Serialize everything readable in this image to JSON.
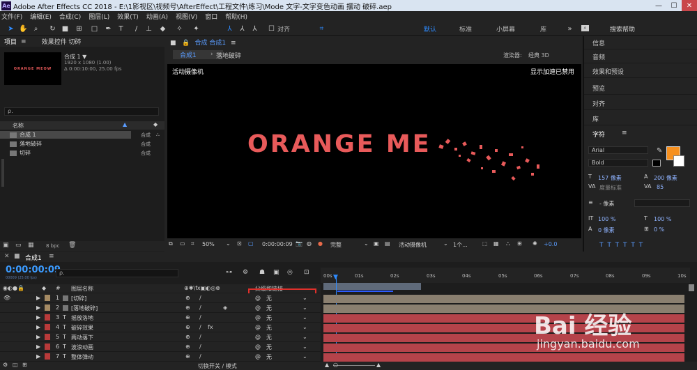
{
  "window": {
    "logo": "Ae",
    "title": "Adobe After Effects CC 2018 - E:\\1影视区\\视频号\\AfterEffect\\工程文件\\练习\\Mode 文字-文字变色动画 摆动 破碎.aep",
    "min": "—",
    "max": "☐",
    "close": "✕"
  },
  "menu": [
    "文件(F)",
    "编辑(E)",
    "合成(C)",
    "图层(L)",
    "效果(T)",
    "动画(A)",
    "视图(V)",
    "窗口",
    "帮助(H)"
  ],
  "toolbar": {
    "align_label": "对齐",
    "workspaces": [
      "默认",
      "标准",
      "小屏幕",
      "库"
    ],
    "search_placeholder": "搜索帮助"
  },
  "project": {
    "tab_project": "项目",
    "tab_effects": "效果控件 切碎",
    "comp_name": "合成 1 ▼",
    "comp_size": "1920 x 1080 (1.00)",
    "comp_duration": "Δ 0:00:10:00, 25.00 fps",
    "thumb_text": "ORANGE MEOW",
    "search_placeholder": "ρ.",
    "col_name": "名称",
    "items": [
      {
        "name": "合成 1",
        "type": "合成"
      },
      {
        "name": "落地破碎",
        "type": "合成"
      },
      {
        "name": "切碎",
        "type": "合成"
      }
    ],
    "bpc": "8 bpc"
  },
  "viewer": {
    "tab_label": "合成 合成1",
    "sub_tab_comp": "合成1",
    "sub_tab_other": "落地破碎",
    "renderer": "渲染器:",
    "renderer_value": "经典 3D",
    "camera_label": "活动摄像机",
    "accel_label": "显示加速已禁用",
    "main_text": "ORANGE ME",
    "bottom": {
      "zoom": "50%",
      "timecode": "0:00:00:09",
      "quality": "完整",
      "camera": "活动摄像机",
      "views": "1个...",
      "exposure": "+0.0"
    }
  },
  "right_panel": {
    "items": [
      "信息",
      "音频",
      "效果和预设",
      "预览",
      "对齐",
      "库"
    ],
    "character": {
      "title": "字符",
      "font": "Arial",
      "style": "Bold",
      "size": "157 像素",
      "leading": "200 像素",
      "kerning": "度量标准",
      "tracking": "85",
      "stroke": "- 像素",
      "v_scale": "100 %",
      "h_scale": "100 %",
      "baseline": "0 像素",
      "tsume": "0 %"
    },
    "fill_color": "#f7901e"
  },
  "timeline": {
    "tab": "合成1",
    "timecode": "0:00:00:09",
    "timecode_sub": "00009 (25.00 fps)",
    "search_placeholder": "ρ.",
    "col_num": "#",
    "col_name": "图层名称",
    "col_parent": "父级和链接",
    "ticks": [
      "00s",
      "01s",
      "02s",
      "03s",
      "04s",
      "05s",
      "06s",
      "07s",
      "08s",
      "09s",
      "10s"
    ],
    "layers": [
      {
        "num": "1",
        "name": "[切碎]",
        "parent": "无",
        "label_color": "#a58a63",
        "bar_color": "#8a7f6f"
      },
      {
        "num": "2",
        "name": "[落地破碎]",
        "parent": "无",
        "label_color": "#a58a63",
        "bar_color": "#8a7f6f"
      },
      {
        "num": "3",
        "name": "摇放洛地",
        "parent": "无",
        "label_color": "#b83a3a",
        "bar_color": "#b5434a"
      },
      {
        "num": "4",
        "name": "破碎效果",
        "parent": "无",
        "label_color": "#b83a3a",
        "bar_color": "#b5434a"
      },
      {
        "num": "5",
        "name": "两动落下",
        "parent": "无",
        "label_color": "#b83a3a",
        "bar_color": "#b5434a"
      },
      {
        "num": "6",
        "name": "波浪动画",
        "parent": "无",
        "label_color": "#b83a3a",
        "bar_color": "#b5434a"
      },
      {
        "num": "7",
        "name": "整体弹动",
        "parent": "无",
        "label_color": "#b83a3a",
        "bar_color": "#b5434a"
      }
    ],
    "footer_toggle": "切换开关 / 模式"
  },
  "watermark": {
    "brand": "Bai 经验",
    "url": "jingyan.baidu.com"
  }
}
